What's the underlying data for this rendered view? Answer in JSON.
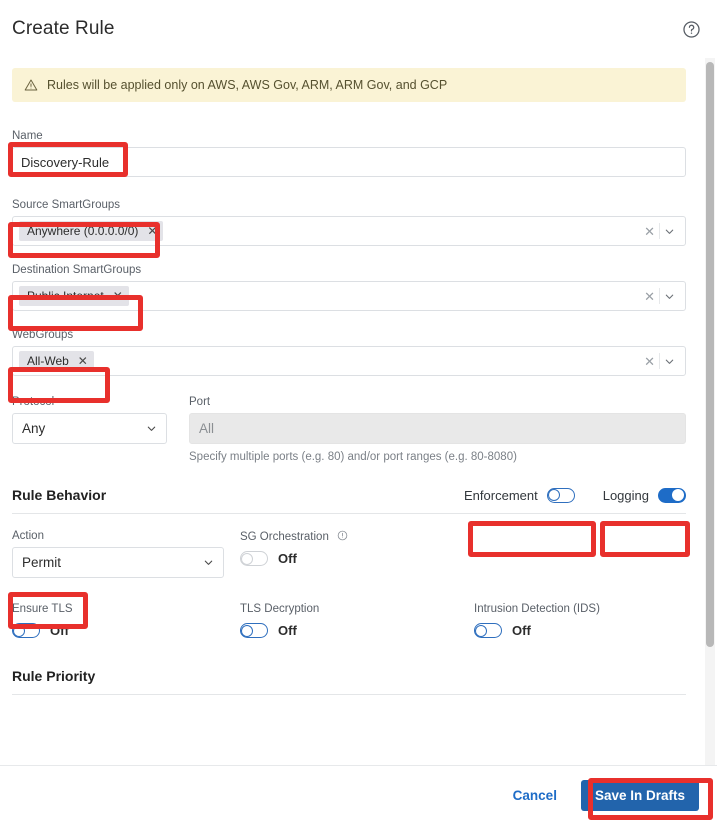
{
  "header": {
    "title": "Create Rule",
    "help_icon": "help-circle-icon"
  },
  "banner": {
    "icon": "warning-triangle-icon",
    "text": "Rules will be applied only on AWS, AWS Gov, ARM, ARM Gov, and GCP"
  },
  "form": {
    "name": {
      "label": "Name",
      "value": "Discovery-Rule",
      "placeholder": ""
    },
    "source_smartgroups": {
      "label": "Source SmartGroups",
      "chips": [
        "Anywhere (0.0.0.0/0)"
      ],
      "clear_icon": "clear-icon",
      "caret_icon": "chevron-down-icon"
    },
    "destination_smartgroups": {
      "label": "Destination SmartGroups",
      "chips": [
        "Public Internet"
      ],
      "clear_icon": "clear-icon",
      "caret_icon": "chevron-down-icon"
    },
    "webgroups": {
      "label": "WebGroups",
      "chips": [
        "All-Web"
      ],
      "clear_icon": "clear-icon",
      "caret_icon": "chevron-down-icon"
    },
    "protocol": {
      "label": "Protocol",
      "value": "Any",
      "caret_icon": "chevron-down-icon"
    },
    "port": {
      "label": "Port",
      "placeholder": "All",
      "value": "",
      "hint": "Specify multiple ports (e.g. 80) and/or port ranges (e.g. 80-8080)"
    }
  },
  "rule_behavior": {
    "title": "Rule Behavior",
    "enforcement": {
      "label": "Enforcement",
      "state": "off"
    },
    "logging": {
      "label": "Logging",
      "state": "on"
    },
    "action": {
      "label": "Action",
      "value": "Permit",
      "caret_icon": "chevron-down-icon"
    },
    "sg_orchestration": {
      "label": "SG Orchestration",
      "info_icon": "info-circle-icon",
      "state_label": "Off",
      "state": "off-disabled"
    },
    "ensure_tls": {
      "label": "Ensure TLS",
      "state_label": "Off",
      "state": "off"
    },
    "tls_decryption": {
      "label": "TLS Decryption",
      "state_label": "Off",
      "state": "off"
    },
    "intrusion_detection": {
      "label": "Intrusion Detection (IDS)",
      "state_label": "Off",
      "state": "off"
    }
  },
  "rule_priority": {
    "title": "Rule Priority"
  },
  "footer": {
    "cancel_label": "Cancel",
    "save_label": "Save In Drafts"
  },
  "colors": {
    "annotation_red": "#e8302c",
    "primary_blue": "#2264ac",
    "toggle_on_blue": "#1e6cc7",
    "banner_bg": "#faf3d5",
    "link_blue": "#1e6cc7"
  }
}
